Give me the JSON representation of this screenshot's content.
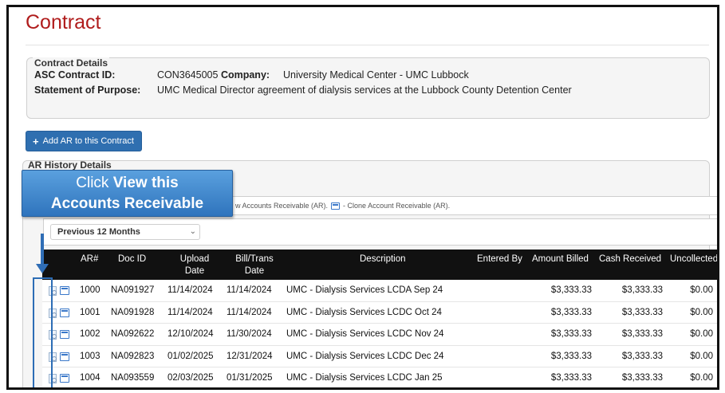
{
  "page": {
    "title": "Contract"
  },
  "contract_details": {
    "legend": "Contract Details",
    "asc_label": "ASC Contract ID:",
    "asc_value": "CON3645005",
    "company_label": "Company:",
    "company_value": "University Medical Center - UMC Lubbock",
    "purpose_label": "Statement of Purpose:",
    "purpose_value": "UMC Medical Director agreement of dialysis services at the Lubbock County Detention Center"
  },
  "add_button": {
    "label": "Add AR to this Contract"
  },
  "history": {
    "legend": "AR History Details",
    "legend_view_text": "w Accounts Receivable (AR).",
    "legend_clone_text": "- Clone Account Receivable (AR).",
    "filter": {
      "selected": "Previous 12 Months"
    },
    "columns": [
      "AR#",
      "Doc ID",
      "Upload Date",
      "Bill/Trans Date",
      "Description",
      "Entered By",
      "Amount Billed",
      "Cash Received",
      "Uncollected"
    ],
    "rows": [
      {
        "ar": "1000",
        "doc": "NA091927",
        "upload": "11/14/2024",
        "bill": "11/14/2024",
        "desc": "UMC - Dialysis Services LCDA Sep 24",
        "entered": "",
        "billed": "$3,333.33",
        "cash": "$3,333.33",
        "uncollected": "$0.00"
      },
      {
        "ar": "1001",
        "doc": "NA091928",
        "upload": "11/14/2024",
        "bill": "11/14/2024",
        "desc": "UMC - Dialysis Services LCDC Oct 24",
        "entered": "",
        "billed": "$3,333.33",
        "cash": "$3,333.33",
        "uncollected": "$0.00"
      },
      {
        "ar": "1002",
        "doc": "NA092622",
        "upload": "12/10/2024",
        "bill": "11/30/2024",
        "desc": "UMC - Dialysis Services LCDC Nov 24",
        "entered": "",
        "billed": "$3,333.33",
        "cash": "$3,333.33",
        "uncollected": "$0.00"
      },
      {
        "ar": "1003",
        "doc": "NA092823",
        "upload": "01/02/2025",
        "bill": "12/31/2024",
        "desc": "UMC - Dialysis Services LCDC Dec 24",
        "entered": "",
        "billed": "$3,333.33",
        "cash": "$3,333.33",
        "uncollected": "$0.00"
      },
      {
        "ar": "1004",
        "doc": "NA093559",
        "upload": "02/03/2025",
        "bill": "01/31/2025",
        "desc": "UMC - Dialysis Services LCDC Jan 25",
        "entered": "",
        "billed": "$3,333.33",
        "cash": "$3,333.33",
        "uncollected": "$0.00"
      }
    ]
  },
  "callout": {
    "line1_a": "Click ",
    "line1_b": "View this",
    "line2": "Accounts  Receivable"
  },
  "colors": {
    "title": "#b01c1c",
    "button": "#2f6fb0",
    "header_bg": "#111111",
    "callout": "#3d86cf"
  },
  "icons": {
    "view": "view-document-icon",
    "clone": "clone-icon",
    "add": "plus-icon"
  }
}
